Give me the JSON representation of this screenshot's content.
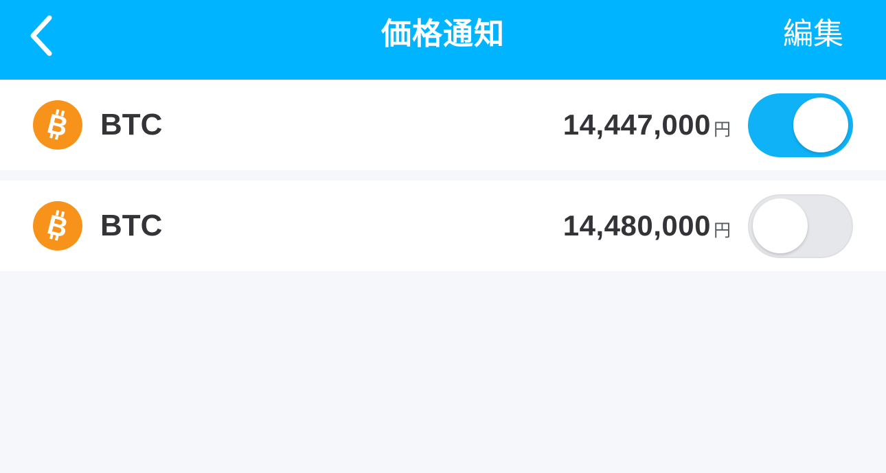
{
  "header": {
    "title": "価格通知",
    "edit_label": "編集",
    "back_icon": "chevron-left-icon",
    "background_color": "#00b4ff"
  },
  "alerts": [
    {
      "coin": "BTC",
      "icon": "bitcoin-icon",
      "price": "14,447,000",
      "unit": "円",
      "enabled": true
    },
    {
      "coin": "BTC",
      "icon": "bitcoin-icon",
      "price": "14,480,000",
      "unit": "円",
      "enabled": false
    }
  ],
  "colors": {
    "accent": "#00b4ff",
    "bitcoin": "#f7931a",
    "toggle_on": "#0fb2f6",
    "toggle_off": "#e6e7ea"
  }
}
